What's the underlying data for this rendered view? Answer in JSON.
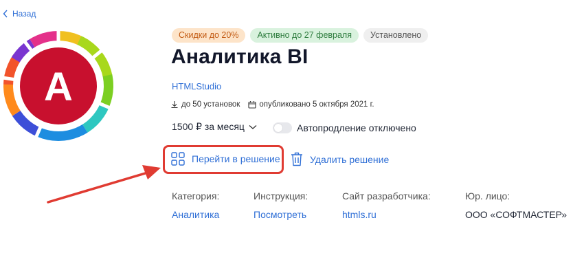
{
  "nav": {
    "back_label": "Назад"
  },
  "product": {
    "logo_letter": "A",
    "badges": [
      "Скидки до 20%",
      "Активно до 27 февраля",
      "Установлено"
    ],
    "title": "Аналитика BI",
    "developer": "HTMLStudio",
    "installs": "до 50 установок",
    "published": "опубликовано 5 октября 2021 г.",
    "price": "1500 ₽ за месяц",
    "autorenew": "Автопродление отключено",
    "autorenew_enabled": false
  },
  "actions": {
    "goto_label": "Перейти в решение",
    "delete_label": "Удалить решение"
  },
  "info": [
    {
      "label": "Категория:",
      "value": "Аналитика"
    },
    {
      "label": "Инструкция:",
      "value": "Посмотреть"
    },
    {
      "label": "Сайт разработчика:",
      "value": "htmls.ru"
    },
    {
      "label": "Юр. лицо:",
      "value": "ООО «СОФТМАСТЕР»"
    }
  ],
  "colors": {
    "accent": "#2f6fd6",
    "highlight": "#e03b32",
    "logo_inner": "#c8102e"
  }
}
